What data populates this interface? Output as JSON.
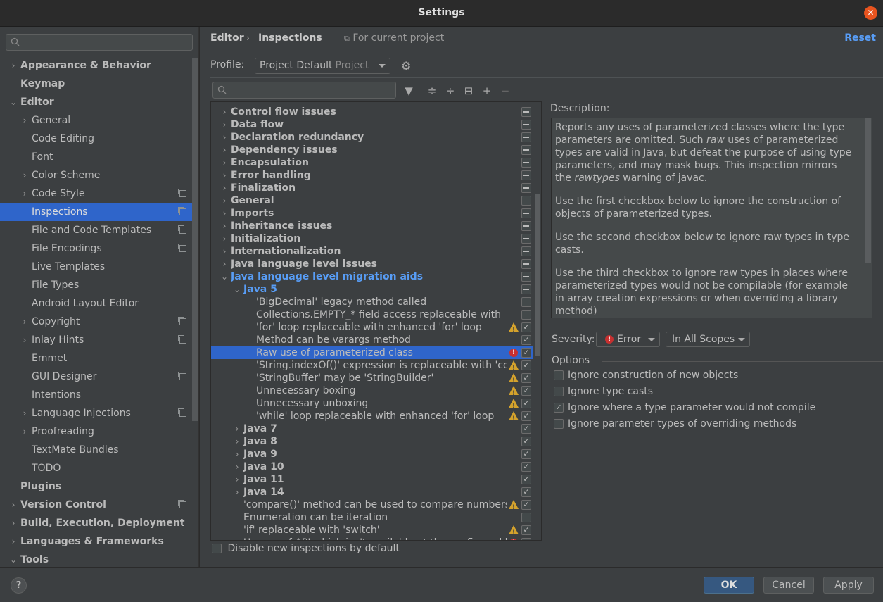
{
  "window": {
    "title": "Settings",
    "close_icon": "close-icon"
  },
  "sidebar": {
    "search_placeholder": "",
    "items": [
      {
        "label": "Appearance & Behavior",
        "level": 0,
        "arrow": "collapsed",
        "bold": true,
        "project": false
      },
      {
        "label": "Keymap",
        "level": 0,
        "arrow": "none",
        "bold": true,
        "project": false
      },
      {
        "label": "Editor",
        "level": 0,
        "arrow": "expanded",
        "bold": true,
        "project": false
      },
      {
        "label": "General",
        "level": 1,
        "arrow": "collapsed",
        "bold": false,
        "project": false
      },
      {
        "label": "Code Editing",
        "level": 1,
        "arrow": "none",
        "bold": false,
        "project": false
      },
      {
        "label": "Font",
        "level": 1,
        "arrow": "none",
        "bold": false,
        "project": false
      },
      {
        "label": "Color Scheme",
        "level": 1,
        "arrow": "collapsed",
        "bold": false,
        "project": false
      },
      {
        "label": "Code Style",
        "level": 1,
        "arrow": "collapsed",
        "bold": false,
        "project": true
      },
      {
        "label": "Inspections",
        "level": 1,
        "arrow": "none",
        "bold": false,
        "project": true,
        "selected": true
      },
      {
        "label": "File and Code Templates",
        "level": 1,
        "arrow": "none",
        "bold": false,
        "project": true
      },
      {
        "label": "File Encodings",
        "level": 1,
        "arrow": "none",
        "bold": false,
        "project": true
      },
      {
        "label": "Live Templates",
        "level": 1,
        "arrow": "none",
        "bold": false,
        "project": false
      },
      {
        "label": "File Types",
        "level": 1,
        "arrow": "none",
        "bold": false,
        "project": false
      },
      {
        "label": "Android Layout Editor",
        "level": 1,
        "arrow": "none",
        "bold": false,
        "project": false
      },
      {
        "label": "Copyright",
        "level": 1,
        "arrow": "collapsed",
        "bold": false,
        "project": true
      },
      {
        "label": "Inlay Hints",
        "level": 1,
        "arrow": "collapsed",
        "bold": false,
        "project": true
      },
      {
        "label": "Emmet",
        "level": 1,
        "arrow": "none",
        "bold": false,
        "project": false
      },
      {
        "label": "GUI Designer",
        "level": 1,
        "arrow": "none",
        "bold": false,
        "project": true
      },
      {
        "label": "Intentions",
        "level": 1,
        "arrow": "none",
        "bold": false,
        "project": false
      },
      {
        "label": "Language Injections",
        "level": 1,
        "arrow": "collapsed",
        "bold": false,
        "project": true
      },
      {
        "label": "Proofreading",
        "level": 1,
        "arrow": "collapsed",
        "bold": false,
        "project": false
      },
      {
        "label": "TextMate Bundles",
        "level": 1,
        "arrow": "none",
        "bold": false,
        "project": false
      },
      {
        "label": "TODO",
        "level": 1,
        "arrow": "none",
        "bold": false,
        "project": false
      },
      {
        "label": "Plugins",
        "level": 0,
        "arrow": "none",
        "bold": true,
        "project": false
      },
      {
        "label": "Version Control",
        "level": 0,
        "arrow": "collapsed",
        "bold": true,
        "project": true
      },
      {
        "label": "Build, Execution, Deployment",
        "level": 0,
        "arrow": "collapsed",
        "bold": true,
        "project": false
      },
      {
        "label": "Languages & Frameworks",
        "level": 0,
        "arrow": "collapsed",
        "bold": true,
        "project": false
      },
      {
        "label": "Tools",
        "level": 0,
        "arrow": "expanded",
        "bold": true,
        "project": false
      }
    ]
  },
  "header": {
    "breadcrumb": [
      "Editor",
      "Inspections"
    ],
    "scope_note": "For current project",
    "reset_label": "Reset"
  },
  "profile": {
    "label": "Profile:",
    "value": "Project Default",
    "sub": "Project"
  },
  "tree": {
    "search_placeholder": "",
    "rows": [
      {
        "label": "Control flow issues",
        "level": 1,
        "arrow": "collapsed",
        "style": "bold",
        "severity": "",
        "check": "mixed"
      },
      {
        "label": "Data flow",
        "level": 1,
        "arrow": "collapsed",
        "style": "bold",
        "severity": "",
        "check": "mixed"
      },
      {
        "label": "Declaration redundancy",
        "level": 1,
        "arrow": "collapsed",
        "style": "bold",
        "severity": "",
        "check": "mixed"
      },
      {
        "label": "Dependency issues",
        "level": 1,
        "arrow": "collapsed",
        "style": "bold",
        "severity": "",
        "check": "mixed"
      },
      {
        "label": "Encapsulation",
        "level": 1,
        "arrow": "collapsed",
        "style": "bold",
        "severity": "",
        "check": "mixed"
      },
      {
        "label": "Error handling",
        "level": 1,
        "arrow": "collapsed",
        "style": "bold",
        "severity": "",
        "check": "mixed"
      },
      {
        "label": "Finalization",
        "level": 1,
        "arrow": "collapsed",
        "style": "bold",
        "severity": "",
        "check": "mixed"
      },
      {
        "label": "General",
        "level": 1,
        "arrow": "collapsed",
        "style": "bold",
        "severity": "",
        "check": "off"
      },
      {
        "label": "Imports",
        "level": 1,
        "arrow": "collapsed",
        "style": "bold",
        "severity": "",
        "check": "mixed"
      },
      {
        "label": "Inheritance issues",
        "level": 1,
        "arrow": "collapsed",
        "style": "bold",
        "severity": "",
        "check": "mixed"
      },
      {
        "label": "Initialization",
        "level": 1,
        "arrow": "collapsed",
        "style": "bold",
        "severity": "",
        "check": "mixed"
      },
      {
        "label": "Internationalization",
        "level": 1,
        "arrow": "collapsed",
        "style": "bold",
        "severity": "",
        "check": "mixed"
      },
      {
        "label": "Java language level issues",
        "level": 1,
        "arrow": "collapsed",
        "style": "bold",
        "severity": "",
        "check": "mixed"
      },
      {
        "label": "Java language level migration aids",
        "level": 1,
        "arrow": "expanded",
        "style": "blue",
        "severity": "",
        "check": "mixed"
      },
      {
        "label": "Java 5",
        "level": 2,
        "arrow": "expanded",
        "style": "blue",
        "severity": "",
        "check": "mixed"
      },
      {
        "label": "'BigDecimal' legacy method called",
        "level": 3,
        "arrow": "none",
        "style": "normal",
        "severity": "",
        "check": "off"
      },
      {
        "label": "Collections.EMPTY_* field access replaceable with",
        "level": 3,
        "arrow": "none",
        "style": "normal",
        "severity": "",
        "check": "off"
      },
      {
        "label": "'for' loop replaceable with enhanced 'for' loop",
        "level": 3,
        "arrow": "none",
        "style": "normal",
        "severity": "warning",
        "check": "on"
      },
      {
        "label": "Method can be varargs method",
        "level": 3,
        "arrow": "none",
        "style": "normal",
        "severity": "",
        "check": "on"
      },
      {
        "label": "Raw use of parameterized class",
        "level": 3,
        "arrow": "none",
        "style": "normal",
        "severity": "error",
        "check": "on",
        "selected": true
      },
      {
        "label": "'String.indexOf()' expression is replaceable with 'contains()'",
        "level": 3,
        "arrow": "none",
        "style": "normal",
        "severity": "warning",
        "check": "on"
      },
      {
        "label": "'StringBuffer' may be 'StringBuilder'",
        "level": 3,
        "arrow": "none",
        "style": "normal",
        "severity": "warning",
        "check": "on"
      },
      {
        "label": "Unnecessary boxing",
        "level": 3,
        "arrow": "none",
        "style": "normal",
        "severity": "warning",
        "check": "on"
      },
      {
        "label": "Unnecessary unboxing",
        "level": 3,
        "arrow": "none",
        "style": "normal",
        "severity": "warning",
        "check": "on"
      },
      {
        "label": "'while' loop replaceable with enhanced 'for' loop",
        "level": 3,
        "arrow": "none",
        "style": "normal",
        "severity": "warning",
        "check": "on"
      },
      {
        "label": "Java 7",
        "level": 2,
        "arrow": "collapsed",
        "style": "bold",
        "severity": "",
        "check": "on"
      },
      {
        "label": "Java 8",
        "level": 2,
        "arrow": "collapsed",
        "style": "bold",
        "severity": "",
        "check": "on"
      },
      {
        "label": "Java 9",
        "level": 2,
        "arrow": "collapsed",
        "style": "bold",
        "severity": "",
        "check": "on"
      },
      {
        "label": "Java 10",
        "level": 2,
        "arrow": "collapsed",
        "style": "bold",
        "severity": "",
        "check": "on"
      },
      {
        "label": "Java 11",
        "level": 2,
        "arrow": "collapsed",
        "style": "bold",
        "severity": "",
        "check": "on"
      },
      {
        "label": "Java 14",
        "level": 2,
        "arrow": "collapsed",
        "style": "bold",
        "severity": "",
        "check": "on"
      },
      {
        "label": "'compare()' method can be used to compare numbers",
        "level": 2,
        "arrow": "none",
        "style": "normal",
        "severity": "warning",
        "check": "on"
      },
      {
        "label": "Enumeration can be iteration",
        "level": 2,
        "arrow": "none",
        "style": "normal",
        "severity": "",
        "check": "off"
      },
      {
        "label": "'if' replaceable with 'switch'",
        "level": 2,
        "arrow": "none",
        "style": "normal",
        "severity": "warning",
        "check": "on"
      },
      {
        "label": "Usages of API which isn't available at the configured language level",
        "level": 2,
        "arrow": "none",
        "style": "normal",
        "severity": "error",
        "check": "on"
      }
    ],
    "disable_new_label": "Disable new inspections by default",
    "disable_new_checked": false
  },
  "toolbar": {
    "icons": [
      "filter-icon",
      "expand-all-icon",
      "collapse-all-icon",
      "reset-to-default-icon",
      "add-icon",
      "remove-icon"
    ]
  },
  "description": {
    "label": "Description:",
    "paragraphs": [
      [
        "Reports any uses of parameterized classes where the type parameters are omitted. Such ",
        {
          "i": "raw"
        },
        " uses of parameterized types are valid in Java, but defeat the purpose of using type parameters, and may mask bugs. This inspection mirrors the ",
        {
          "i": "rawtypes"
        },
        " warning of javac."
      ],
      [
        "Use the first checkbox below to ignore the construction of objects of parameterized types."
      ],
      [
        "Use the second checkbox below to ignore raw types in type casts."
      ],
      [
        "Use the third checkbox to ignore raw types in places where parameterized types would not be compilable (for example in array creation expressions or when overriding a library method)"
      ]
    ]
  },
  "severity": {
    "label": "Severity:",
    "value": "Error",
    "scope": "In All Scopes",
    "error_color": "#c73030"
  },
  "options": {
    "title": "Options",
    "items": [
      {
        "label": "Ignore construction of new objects",
        "checked": false
      },
      {
        "label": "Ignore type casts",
        "checked": false
      },
      {
        "label": "Ignore where a type parameter would not compile",
        "checked": true
      },
      {
        "label": "Ignore parameter types of overriding methods",
        "checked": false
      }
    ]
  },
  "footer": {
    "help": "?",
    "ok": "OK",
    "cancel": "Cancel",
    "apply": "Apply"
  },
  "colors": {
    "accent": "#589df6",
    "selection": "#2f65ca",
    "warning": "#d4a22c",
    "error": "#c73030",
    "close": "#e9541f"
  }
}
